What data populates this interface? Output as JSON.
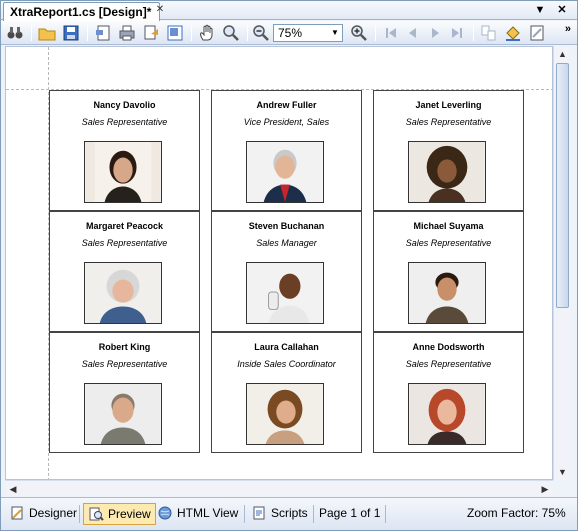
{
  "document_tab": {
    "title": "XtraReport1.cs [Design]*"
  },
  "window_buttons": {
    "pin": "▼",
    "close": "✕"
  },
  "toolbar": {
    "zoom_value": "75%",
    "buttons": [
      "find-icon",
      "open-icon",
      "save-icon",
      "page-setup-icon",
      "print-icon",
      "print-quick-icon",
      "scale-icon",
      "hand-tool-icon",
      "magnifier-icon",
      "zoom-out-icon",
      "zoom-in-icon",
      "first-page-icon",
      "previous-page-icon",
      "next-page-icon",
      "last-page-icon",
      "multiple-pages-icon",
      "background-color-icon",
      "watermark-icon"
    ]
  },
  "cards": [
    {
      "name": "Nancy Davolio",
      "title": "Sales Representative"
    },
    {
      "name": "Andrew Fuller",
      "title": "Vice President, Sales"
    },
    {
      "name": "Janet Leverling",
      "title": "Sales Representative"
    },
    {
      "name": "Margaret Peacock",
      "title": "Sales Representative"
    },
    {
      "name": "Steven Buchanan",
      "title": "Sales Manager"
    },
    {
      "name": "Michael Suyama",
      "title": "Sales Representative"
    },
    {
      "name": "Robert King",
      "title": "Sales Representative"
    },
    {
      "name": "Laura Callahan",
      "title": "Inside Sales Coordinator"
    },
    {
      "name": "Anne Dodsworth",
      "title": "Sales Representative"
    }
  ],
  "status_bar": {
    "tabs": [
      {
        "label": "Designer",
        "icon": "designer-icon",
        "active": false
      },
      {
        "label": "Preview",
        "icon": "preview-icon",
        "active": true
      },
      {
        "label": "HTML View",
        "icon": "html-view-icon",
        "active": false
      },
      {
        "label": "Scripts",
        "icon": "scripts-icon",
        "active": false
      }
    ],
    "page_info": "Page 1 of 1",
    "zoom_factor": "Zoom Factor: 75%"
  },
  "colors": {
    "active_tab": "#fdeab0",
    "chrome": "#dce5f2",
    "border": "#7f9db9"
  }
}
